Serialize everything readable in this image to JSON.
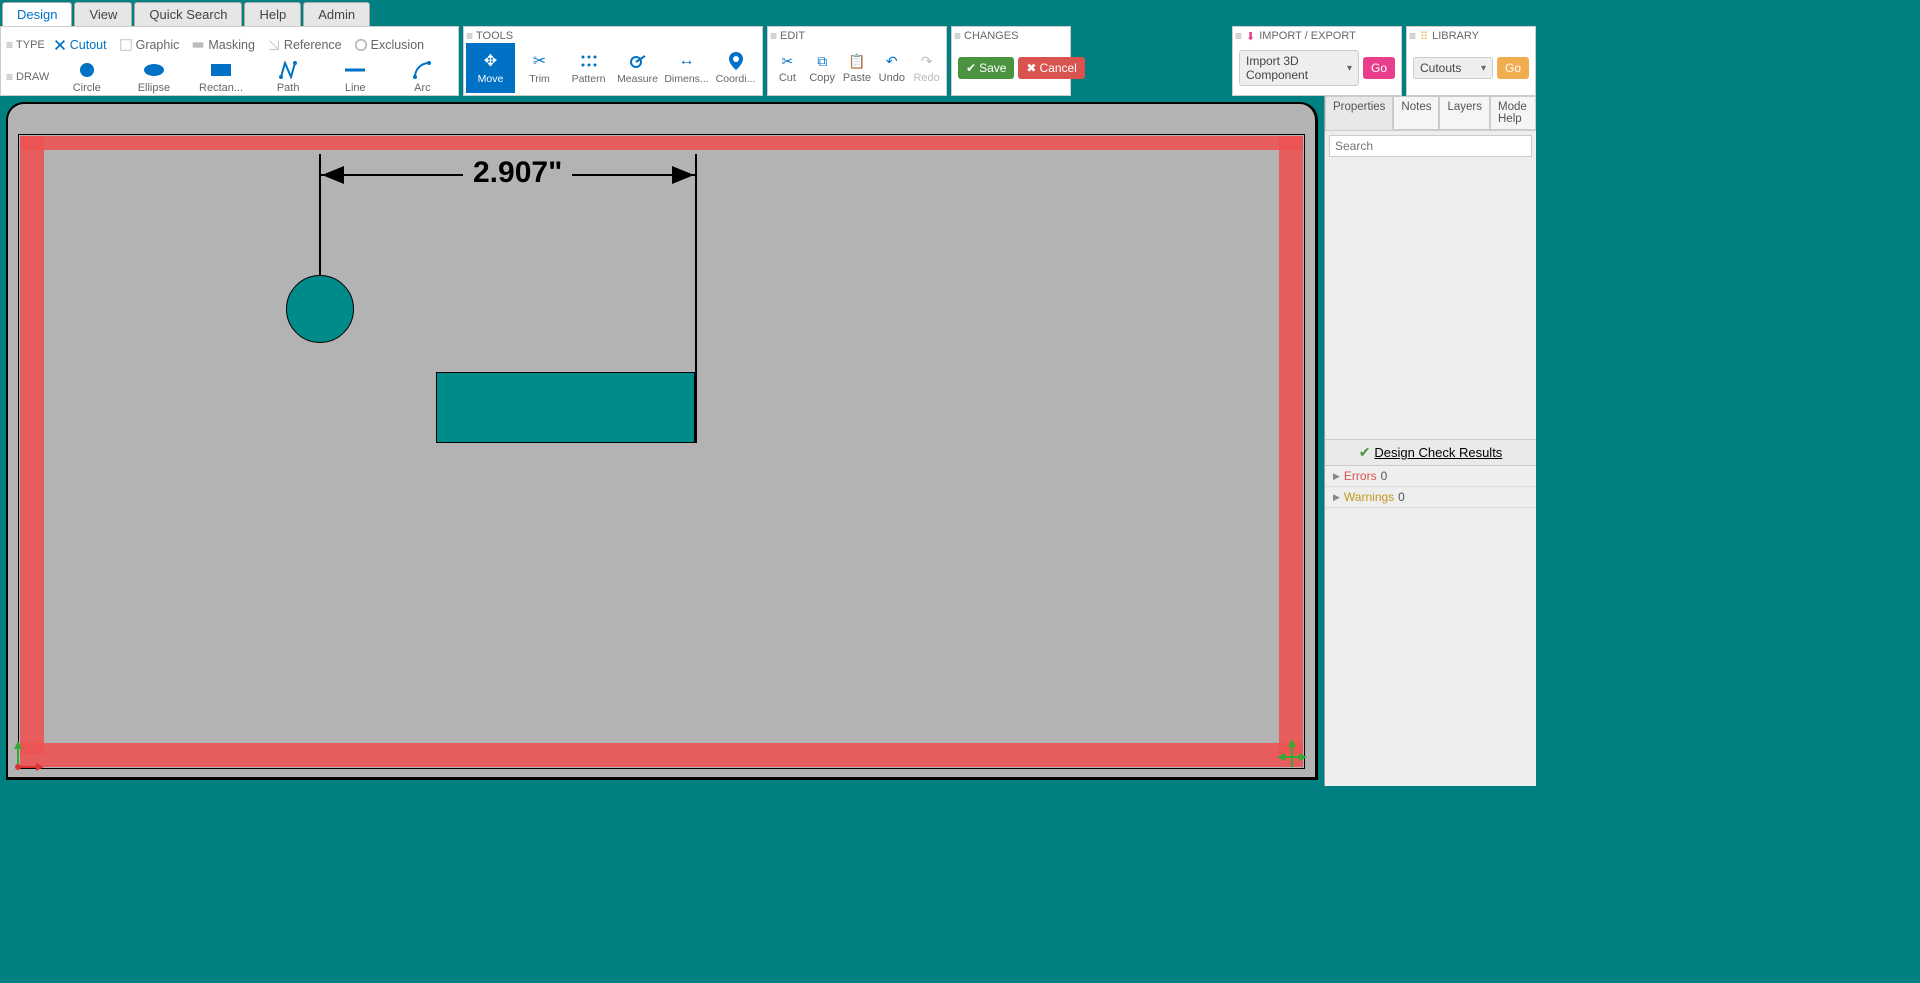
{
  "tabs": {
    "design": "Design",
    "view": "View",
    "quicksearch": "Quick Search",
    "help": "Help",
    "admin": "Admin"
  },
  "typedraw": {
    "type_label": "TYPE",
    "draw_label": "DRAW",
    "cutout": "Cutout",
    "graphic": "Graphic",
    "masking": "Masking",
    "reference": "Reference",
    "exclusion": "Exclusion",
    "circle": "Circle",
    "ellipse": "Ellipse",
    "rectangle": "Rectan...",
    "path": "Path",
    "line": "Line",
    "arc": "Arc"
  },
  "tools": {
    "title": "TOOLS",
    "move": "Move",
    "trim": "Trim",
    "pattern": "Pattern",
    "measure": "Measure",
    "dimension": "Dimens...",
    "coordinates": "Coordi..."
  },
  "edit": {
    "title": "EDIT",
    "cut": "Cut",
    "copy": "Copy",
    "paste": "Paste",
    "undo": "Undo",
    "redo": "Redo"
  },
  "changes": {
    "title": "CHANGES",
    "save": "Save",
    "cancel": "Cancel"
  },
  "import": {
    "title": "IMPORT / EXPORT",
    "dropdown": "Import 3D Component",
    "go": "Go"
  },
  "library": {
    "title": "LIBRARY",
    "dropdown": "Cutouts",
    "go": "Go"
  },
  "canvas": {
    "dimension_value": "2.907\""
  },
  "side": {
    "properties": "Properties",
    "notes": "Notes",
    "layers": "Layers",
    "modehelp": "Mode Help",
    "search_placeholder": "Search",
    "dcr": "Design Check Results",
    "errors_label": "Errors",
    "errors_count": "0",
    "warnings_label": "Warnings",
    "warnings_count": "0"
  }
}
